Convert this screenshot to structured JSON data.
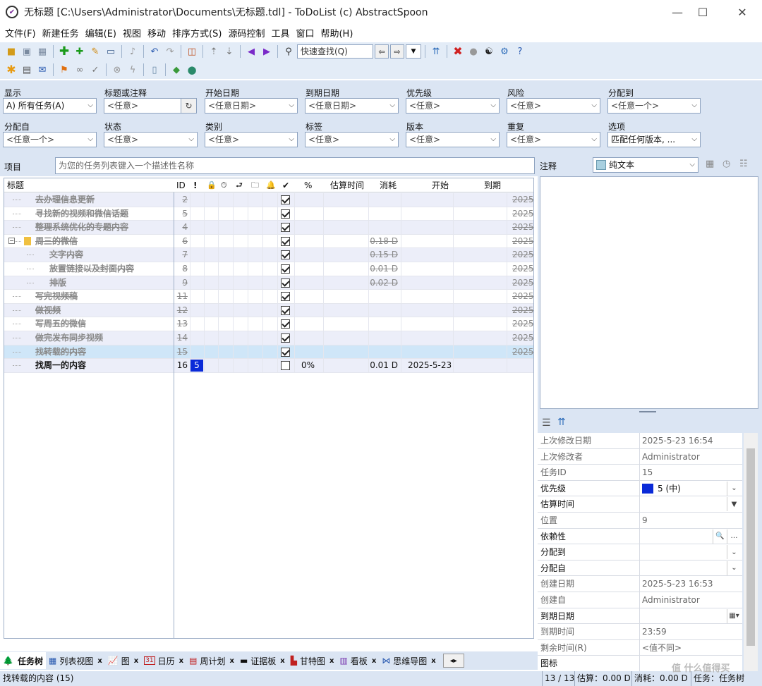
{
  "window": {
    "title": "无标题 [C:\\Users\\Administrator\\Documents\\无标题.tdl] - ToDoList (c) AbstractSpoon",
    "app_icon_glyph": "✔",
    "minimize": "—",
    "maximize": "☐",
    "close": "✕"
  },
  "menu": [
    "文件(F)",
    "新建任务",
    "编辑(E)",
    "视图",
    "移动",
    "排序方式(S)",
    "源码控制",
    "工具",
    "窗口",
    "帮助(H)"
  ],
  "toolbar1": {
    "quick_find_placeholder": "快速查找(Q)"
  },
  "filters": {
    "show": {
      "label": "显示",
      "value": "A) 所有任务(A)"
    },
    "title": {
      "label": "标题或注释",
      "value": "<任意>"
    },
    "start": {
      "label": "开始日期",
      "value": "<任意日期>"
    },
    "due": {
      "label": "到期日期",
      "value": "<任意日期>"
    },
    "priority": {
      "label": "优先级",
      "value": "<任意>"
    },
    "risk": {
      "label": "风险",
      "value": "<任意>"
    },
    "assigned": {
      "label": "分配到",
      "value": "<任意一个>"
    },
    "allocated_by": {
      "label": "分配自",
      "value": "<任意一个>"
    },
    "status": {
      "label": "状态",
      "value": "<任意>"
    },
    "category": {
      "label": "类别",
      "value": "<任意>"
    },
    "tags": {
      "label": "标签",
      "value": "<任意>"
    },
    "version": {
      "label": "版本",
      "value": "<任意>"
    },
    "recur": {
      "label": "重复",
      "value": "<任意>"
    },
    "options": {
      "label": "选项",
      "value": "匹配任何版本, ..."
    }
  },
  "project": {
    "label": "项目",
    "placeholder": "为您的任务列表键入一个描述性名称"
  },
  "grid": {
    "headers": {
      "title": "标题",
      "id": "ID",
      "prio": "!",
      "lock": "🔒",
      "time": "⏱",
      "dep": "⮐",
      "file": "🗀",
      "remind": "🔔",
      "done": "✔",
      "percent": "%",
      "est": "估算时间",
      "spent": "消耗",
      "start": "开始",
      "due": "到期"
    },
    "rows": [
      {
        "title": "去办理信息更新",
        "id": "2",
        "spent": "",
        "start": "",
        "due": "2025",
        "done": true,
        "level": 0
      },
      {
        "title": "寻找新的视频和微信话题",
        "id": "5",
        "spent": "",
        "start": "",
        "due": "2025",
        "done": true,
        "level": 0
      },
      {
        "title": "整理系统优化的专题内容",
        "id": "4",
        "spent": "",
        "start": "",
        "due": "2025",
        "done": true,
        "level": 0
      },
      {
        "title": "周三的微信",
        "id": "6",
        "spent": "0.18 D",
        "start": "",
        "due": "2025",
        "done": true,
        "level": 0,
        "folder": true
      },
      {
        "title": "文字内容",
        "id": "7",
        "spent": "0.15 D",
        "start": "",
        "due": "2025",
        "done": true,
        "level": 1
      },
      {
        "title": "放置链接以及封面内容",
        "id": "8",
        "spent": "0.01 D",
        "start": "",
        "due": "2025",
        "done": true,
        "level": 1
      },
      {
        "title": "排版",
        "id": "9",
        "spent": "0.02 D",
        "start": "",
        "due": "2025",
        "done": true,
        "level": 1
      },
      {
        "title": "写完视频稿",
        "id": "11",
        "spent": "",
        "start": "",
        "due": "2025",
        "done": true,
        "level": 0
      },
      {
        "title": "做视频",
        "id": "12",
        "spent": "",
        "start": "",
        "due": "2025",
        "done": true,
        "level": 0
      },
      {
        "title": "写周五的微信",
        "id": "13",
        "spent": "",
        "start": "",
        "due": "2025",
        "done": true,
        "level": 0
      },
      {
        "title": "做完发布同步视频",
        "id": "14",
        "spent": "",
        "start": "",
        "due": "2025",
        "done": true,
        "level": 0
      },
      {
        "title": "找转载的内容",
        "id": "15",
        "spent": "",
        "start": "",
        "due": "2025",
        "done": true,
        "level": 0,
        "selected": true
      },
      {
        "title": "找周一的内容",
        "id": "16",
        "prio": "5",
        "percent": "0%",
        "spent": "0.01 D",
        "start": "2025-5-23",
        "due": "",
        "done": false,
        "level": 0
      }
    ]
  },
  "tabs": [
    {
      "label": "任务树",
      "icon": "🌲",
      "active": true
    },
    {
      "label": "列表视图",
      "icon": "▦"
    },
    {
      "label": "图",
      "icon": "📈"
    },
    {
      "label": "日历",
      "icon": "31"
    },
    {
      "label": "周计划",
      "icon": "▤"
    },
    {
      "label": "证据板",
      "icon": "▬"
    },
    {
      "label": "甘特图",
      "icon": "▙"
    },
    {
      "label": "看板",
      "icon": "▥"
    },
    {
      "label": "思维导图",
      "icon": "⋈"
    }
  ],
  "notes": {
    "label": "注释",
    "format": "纯文本"
  },
  "props": [
    {
      "label": "上次修改日期",
      "value": "2025-5-23 16:54",
      "ro": true
    },
    {
      "label": "上次修改者",
      "value": "Administrator",
      "ro": true
    },
    {
      "label": "任务ID",
      "value": "15",
      "ro": true
    },
    {
      "label": "优先级",
      "value": "5 (中)",
      "swatch": true,
      "btn": "⌄"
    },
    {
      "label": "估算时间",
      "value": "",
      "btn": "▼"
    },
    {
      "label": "位置",
      "value": "9",
      "ro": true
    },
    {
      "label": "依赖性",
      "value": "",
      "btn": "🔍",
      "btn2": "…"
    },
    {
      "label": "分配到",
      "value": "",
      "btn": "⌄"
    },
    {
      "label": "分配自",
      "value": "",
      "btn": "⌄"
    },
    {
      "label": "创建日期",
      "value": "2025-5-23 16:53",
      "ro": true
    },
    {
      "label": "创建自",
      "value": "Administrator",
      "ro": true
    },
    {
      "label": "到期日期",
      "value": "",
      "btn": "▦▾"
    },
    {
      "label": "到期时间",
      "value": "23:59",
      "ro": true
    },
    {
      "label": "剩余时间(R)",
      "value": "<值不同>",
      "ro": true
    },
    {
      "label": "图标",
      "value": "",
      "ro": false
    }
  ],
  "status": {
    "left": "找转载的内容   (15)",
    "count": "13 / 13",
    "est": "估算：0.00 D",
    "spent": "消耗：0.00 D",
    "view": "任务：任务树"
  },
  "watermark": "值 什么值得买",
  "colors": {
    "accent": "#0a2ad8",
    "chrome": "#dbe5f3",
    "toolbar": "#e3ecf7",
    "selected": "#cfe6f8",
    "alt_row": "#eceef9"
  }
}
